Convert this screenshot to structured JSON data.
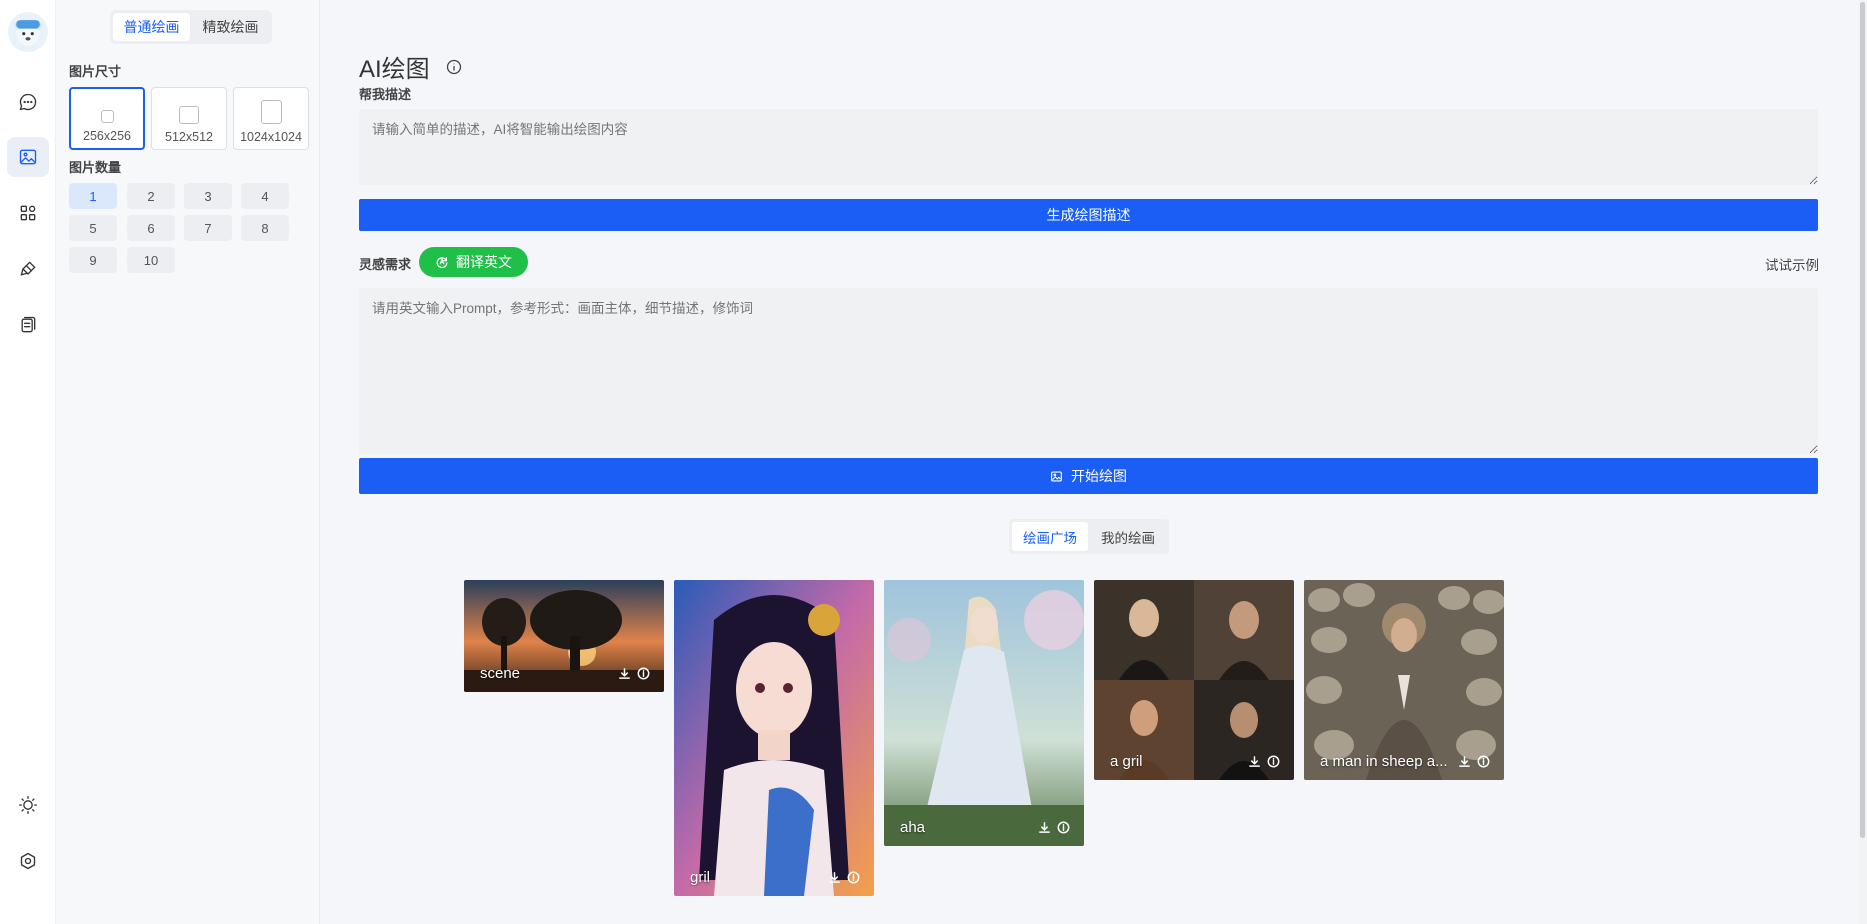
{
  "colors": {
    "accent": "#1a5ef5",
    "translate": "#1fbf4a"
  },
  "rail": {
    "items": [
      {
        "icon": "chat-icon"
      },
      {
        "icon": "image-icon"
      },
      {
        "icon": "apps-icon"
      },
      {
        "icon": "brush-icon"
      },
      {
        "icon": "document-icon"
      }
    ],
    "bottom": [
      {
        "icon": "sun-icon"
      },
      {
        "icon": "settings-icon"
      }
    ]
  },
  "panel": {
    "modes": [
      "普通绘画",
      "精致绘画"
    ],
    "active_mode": "普通绘画",
    "size_label": "图片尺寸",
    "sizes": [
      "256x256",
      "512x512",
      "1024x1024"
    ],
    "active_size": "256x256",
    "count_label": "图片数量",
    "counts": [
      "1",
      "2",
      "3",
      "4",
      "5",
      "6",
      "7",
      "8",
      "9",
      "10"
    ],
    "active_count": "1"
  },
  "main": {
    "title": "AI绘图",
    "help_label": "帮我描述",
    "help_placeholder": "请输入简单的描述，AI将智能输出绘图内容",
    "generate_button": "生成绘图描述",
    "inspiration_label": "灵感需求",
    "translate_button": "翻译英文",
    "example_link": "试试示例",
    "prompt_placeholder": "请用英文输入Prompt，参考形式：画面主体，细节描述，修饰词",
    "start_button": "开始绘图",
    "gallery_tabs": [
      "绘画广场",
      "我的绘画"
    ],
    "active_gallery_tab": "绘画广场"
  },
  "gallery": [
    {
      "caption": "scene"
    },
    {
      "caption": "gril"
    },
    {
      "caption": "aha"
    },
    {
      "caption": "a gril"
    },
    {
      "caption": "a man in sheep a..."
    }
  ]
}
